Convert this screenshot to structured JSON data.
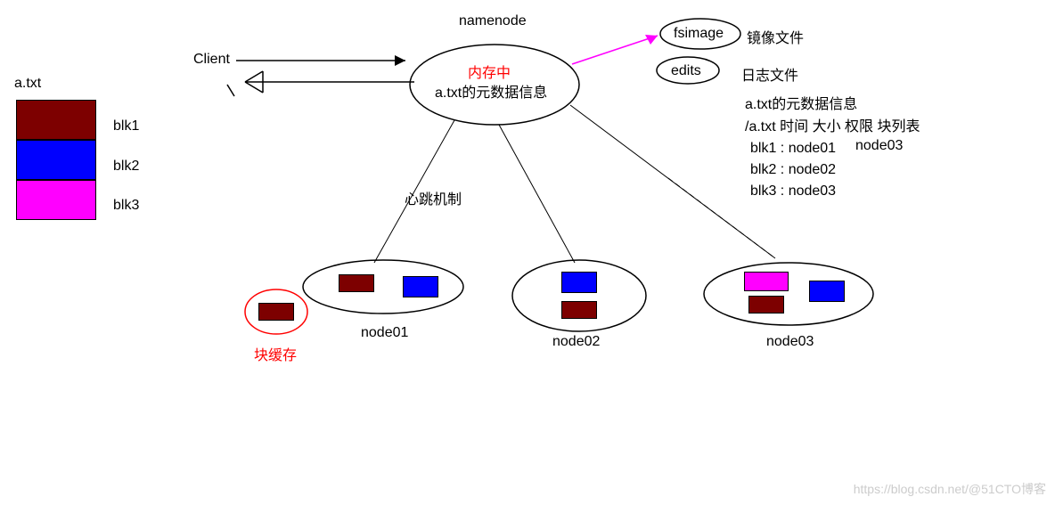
{
  "file": {
    "name": "a.txt",
    "blocks": [
      {
        "id": "blk1",
        "color": "maroon"
      },
      {
        "id": "blk2",
        "color": "blue"
      },
      {
        "id": "blk3",
        "color": "magenta"
      }
    ]
  },
  "client_label": "Client",
  "namenode": {
    "title": "namenode",
    "memory_label": "内存中",
    "metadata_label": "a.txt的元数据信息"
  },
  "files": {
    "fsimage": {
      "label": "fsimage",
      "desc": "镜像文件"
    },
    "edits": {
      "label": "edits",
      "desc": "日志文件"
    }
  },
  "metadata_info": {
    "title": "a.txt的元数据信息",
    "row": "/a.txt  时间  大小 权限  块列表",
    "blk1": "blk1 : node01",
    "blk1_extra": "node03",
    "blk2": "blk2 : node02",
    "blk3": "blk3 : node03"
  },
  "heartbeat": "心跳机制",
  "datanodes": {
    "node01": "node01",
    "node02": "node02",
    "node03": "node03"
  },
  "block_cache": "块缓存",
  "watermark": "https://blog.csdn.net/@51CTO博客"
}
